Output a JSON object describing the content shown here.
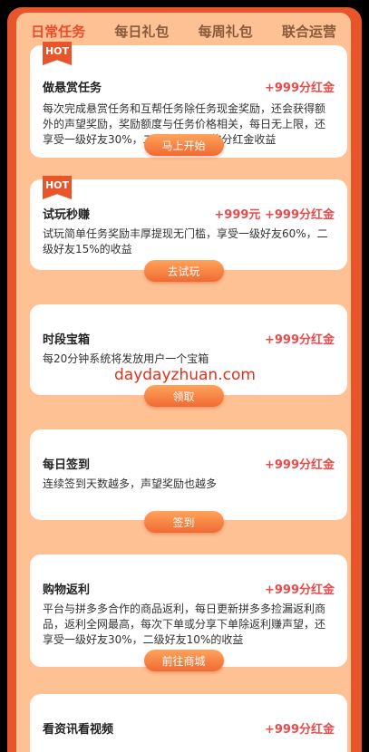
{
  "tabs": [
    {
      "label": "日常任务",
      "active": true
    },
    {
      "label": "每日礼包",
      "active": false
    },
    {
      "label": "每周礼包",
      "active": false
    },
    {
      "label": "联合运营",
      "active": false
    }
  ],
  "hot_label": "HOT",
  "cards": [
    {
      "title": "做悬赏任务",
      "reward": "+999分红金",
      "desc": "每次完成悬赏任务和互帮任务除任务现金奖励，还会获得额外的声望奖励，奖励额度与任务价格相关，每日无上限，还享受一级好友30%，二级好友10%的分红金收益",
      "button": "马上开始"
    },
    {
      "title": "试玩秒赚",
      "reward": "+999元 +999分红金",
      "desc": "试玩简单任务奖励丰厚提现无门槛，享受一级好友60%，二级好友15%的收益",
      "button": "去试玩"
    },
    {
      "title": "时段宝箱",
      "reward": "+999分红金",
      "desc": "每20分钟系统将发放用户一个宝箱",
      "button": "领取"
    },
    {
      "title": "每日签到",
      "reward": "+999分红金",
      "desc": "连续签到天数越多，声望奖励也越多",
      "button": "签到"
    },
    {
      "title": "购物返利",
      "reward": "+999分红金",
      "desc": "平台与拼多多合作的商品返利，每日更新拼多多捡漏返利商品，返利全网最高，每次下单或分享下单除返利赚声望，还享受一级好友30%，二级好友10%的收益",
      "button": "前往商城"
    },
    {
      "title": "看资讯看视频",
      "reward": "+999分红金"
    }
  ],
  "watermark": "daydayzhuan.com",
  "colors": {
    "accent": "#e94b2b",
    "panel": "#fdc193",
    "frame": "#e8552a",
    "reward": "#e94b4b"
  }
}
